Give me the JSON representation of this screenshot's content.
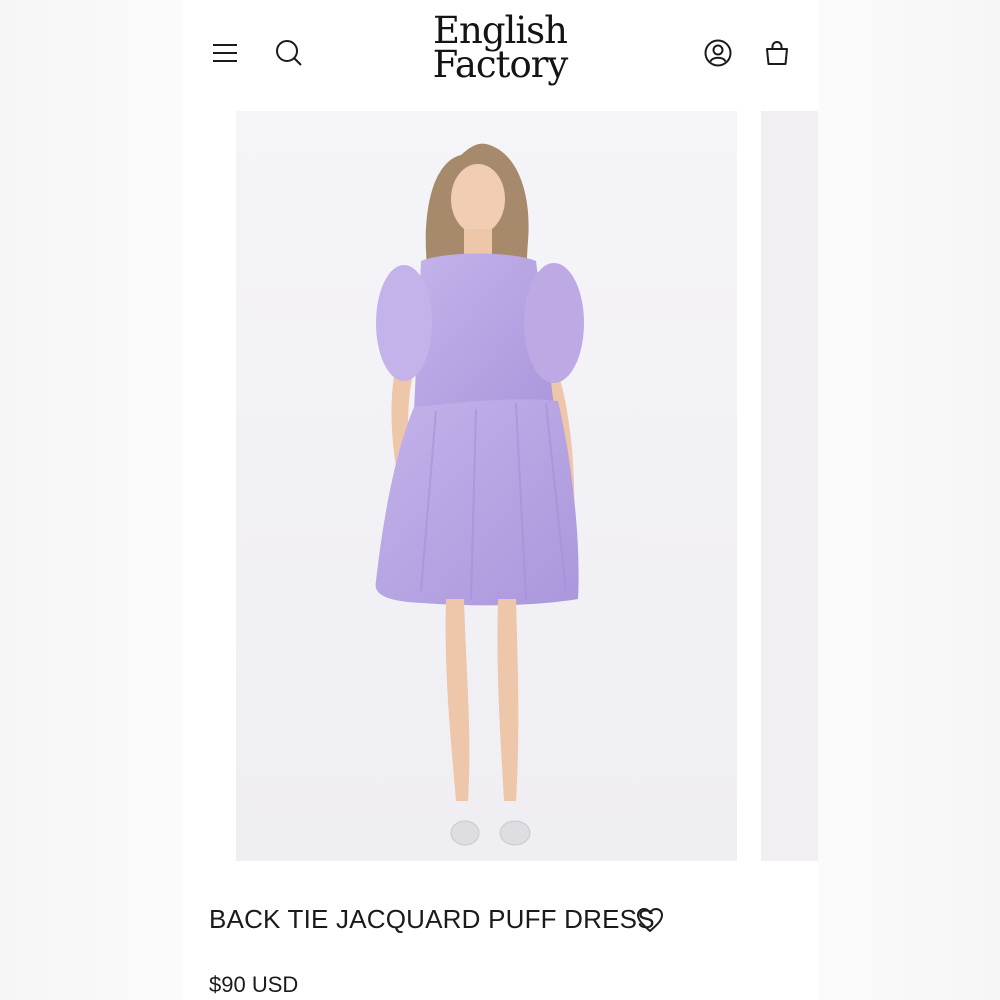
{
  "brand": {
    "logo_line1": "English",
    "logo_line2": "Factory"
  },
  "header": {
    "icons": [
      "menu-icon",
      "search-icon",
      "account-icon",
      "cart-icon"
    ]
  },
  "product": {
    "title": "BACK TIE JACQUARD PUFF DRESS",
    "price": "$90 USD",
    "image": "model-in-lavender-puff-sleeve-dress",
    "dress_color": "#b9a6e4",
    "wishlist_icon": "heart-icon"
  },
  "colors": {
    "text": "#1b1b1b",
    "background": "#ffffff",
    "image_background": "#f3f2f6"
  }
}
